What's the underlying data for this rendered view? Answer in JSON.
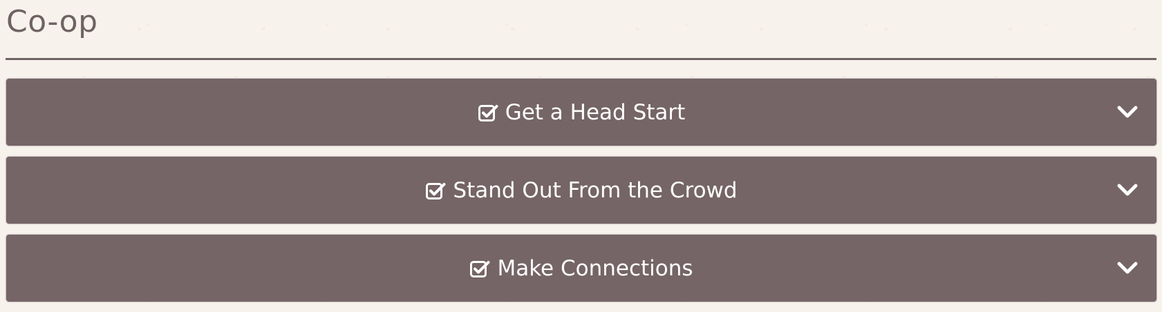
{
  "section": {
    "title": "Co-op"
  },
  "accordion": {
    "items": [
      {
        "label": "Get a Head Start",
        "icon": "checkbox-checked-icon",
        "toggle_icon": "chevron-down-icon"
      },
      {
        "label": "Stand Out From the Crowd",
        "icon": "checkbox-checked-icon",
        "toggle_icon": "chevron-down-icon"
      },
      {
        "label": "Make Connections",
        "icon": "checkbox-checked-icon",
        "toggle_icon": "chevron-down-icon"
      }
    ]
  },
  "colors": {
    "panel_background": "#756567",
    "title_text": "#6f6264",
    "panel_text": "#ffffff",
    "page_background": "#f7f3ec"
  }
}
